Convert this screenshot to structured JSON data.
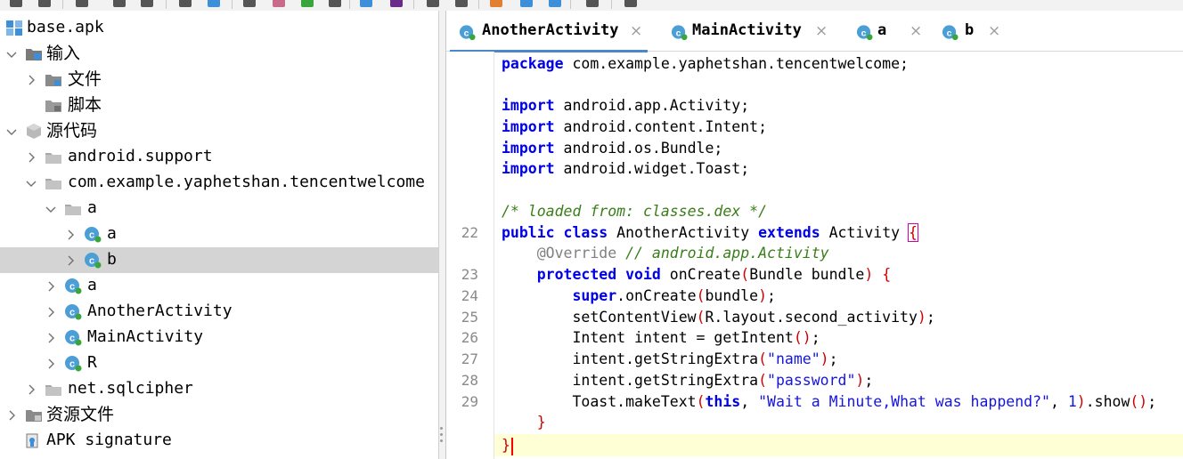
{
  "toolbar": {
    "icons": [
      "open-icon",
      "add-icon",
      "refresh-icon",
      "save-icon",
      "export-icon",
      "download-icon",
      "modules-icon",
      "search-icon",
      "find-class-icon",
      "find-usage-icon",
      "home-icon",
      "window-icon",
      "terminal-icon",
      "back-icon",
      "forward-icon",
      "debug-settings-icon",
      "decompile-icon",
      "settings-icon",
      "log-icon",
      "tools-icon"
    ]
  },
  "tree": {
    "items": [
      {
        "label": "base.apk",
        "icon": "apk-icon"
      },
      {
        "label": "输入",
        "icon": "input-folder-icon"
      },
      {
        "label": "文件",
        "icon": "folder-icon"
      },
      {
        "label": "脚本",
        "icon": "script-folder-icon"
      },
      {
        "label": "源代码",
        "icon": "source-package-icon"
      },
      {
        "label": "android.support",
        "icon": "package-icon"
      },
      {
        "label": "com.example.yaphetshan.tencentwelcome",
        "icon": "package-icon"
      },
      {
        "label": "a",
        "icon": "package-icon"
      },
      {
        "label": "a",
        "icon": "class-icon"
      },
      {
        "label": "b",
        "icon": "class-icon"
      },
      {
        "label": "a",
        "icon": "class-icon"
      },
      {
        "label": "AnotherActivity",
        "icon": "class-icon"
      },
      {
        "label": "MainActivity",
        "icon": "class-icon"
      },
      {
        "label": "R",
        "icon": "class-icon"
      },
      {
        "label": "net.sqlcipher",
        "icon": "package-icon"
      },
      {
        "label": "资源文件",
        "icon": "resources-folder-icon"
      },
      {
        "label": "APK signature",
        "icon": "signature-icon"
      }
    ]
  },
  "editor": {
    "tabs": [
      {
        "label": "AnotherActivity",
        "active": true
      },
      {
        "label": "MainActivity",
        "active": false
      },
      {
        "label": "a",
        "active": false
      },
      {
        "label": "b",
        "active": false
      }
    ],
    "close_glyph": "×",
    "line_numbers": [
      "22",
      "23",
      "24",
      "25",
      "26",
      "27",
      "28",
      "29"
    ],
    "code": {
      "l1_kw": "package",
      "l1_rest": " com.example.yaphetshan.tencentwelcome;",
      "l2_kw": "import",
      "l2_rest": " android.app.Activity;",
      "l3_kw": "import",
      "l3_rest": " android.content.Intent;",
      "l4_kw": "import",
      "l4_rest": " android.os.Bundle;",
      "l5_kw": "import",
      "l5_rest": " android.widget.Toast;",
      "l6_comment": "/* loaded from: classes.dex */",
      "l7_kw1": "public",
      "l7_kw2": "class",
      "l7_name": "AnotherActivity",
      "l7_kw3": "extends",
      "l7_super": "Activity",
      "open_brace": "{",
      "l8_annotation": "@Override",
      "l8_comment": "// android.app.Activity",
      "l9_kw1": "protected",
      "l9_kw2": "void",
      "l9_method": "onCreate",
      "l9_params": "Bundle bundle",
      "l10_kw": "super",
      "l10_rest": ".onCreate",
      "l10_arg": "bundle",
      "l11_call": "setContentView",
      "l11_arg": "R.layout.second_activity",
      "l12_decl": "Intent intent = getIntent",
      "l13_call": "intent.getStringExtra",
      "l13_str": "\"name\"",
      "l14_call": "intent.getStringExtra",
      "l14_str": "\"password\"",
      "l15_call": "Toast.makeText",
      "l15_kw": "this",
      "l15_str": "\"Wait a Minute,What was happend?\"",
      "l15_num": "1",
      "l15_show": ".show",
      "close_brace": "}"
    }
  },
  "colors": {
    "keyword": "#0000e6",
    "comment": "#3a7d1a",
    "string": "#1515e0",
    "paren": "#d00000",
    "current_line": "#ffffd6",
    "tab_underline": "#4a88c7",
    "selected_row": "#d4d4d4"
  }
}
